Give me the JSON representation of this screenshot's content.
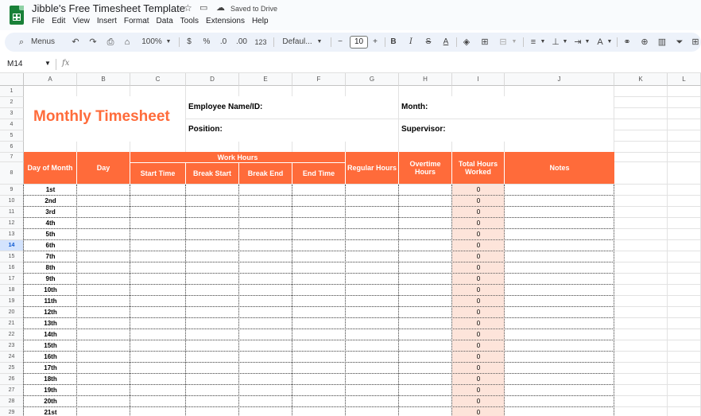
{
  "app": {
    "doc_title": "Jibble's Free Timesheet Template",
    "save_status": "Saved to Drive",
    "menu": [
      "File",
      "Edit",
      "View",
      "Insert",
      "Format",
      "Data",
      "Tools",
      "Extensions",
      "Help"
    ]
  },
  "toolbar": {
    "menus_label": "Menus",
    "zoom": "100%",
    "currency": "$",
    "percent": "%",
    "dec_decrease": ".0",
    "dec_increase": ".00",
    "number_format": "123",
    "font": "Defaul...",
    "font_size": "10",
    "bold": "B",
    "italic": "I",
    "strike": "S",
    "text_color": "A"
  },
  "formula_bar": {
    "cell_ref": "M14",
    "fx": "fx"
  },
  "columns": [
    "A",
    "B",
    "C",
    "D",
    "E",
    "F",
    "G",
    "H",
    "I",
    "J",
    "K",
    "L"
  ],
  "rows": [
    "1",
    "2",
    "3",
    "4",
    "5",
    "6",
    "7",
    "8",
    "9",
    "10",
    "11",
    "12",
    "13",
    "14",
    "15",
    "16",
    "17",
    "18",
    "19",
    "20",
    "21",
    "22",
    "23",
    "24",
    "25",
    "26",
    "27",
    "28",
    "29"
  ],
  "active_row": "14",
  "sheet": {
    "title": "Monthly Timesheet",
    "employee_label": "Employee Name/ID:",
    "position_label": "Position:",
    "month_label": "Month:",
    "supervisor_label": "Supervisor:",
    "headers": {
      "day_of_month": "Day of Month",
      "day": "Day",
      "work_hours": "Work Hours",
      "start_time": "Start Time",
      "break_start": "Break Start",
      "break_end": "Break End",
      "end_time": "End Time",
      "regular_hours": "Regular Hours",
      "overtime_hours": "Overtime Hours",
      "total_hours": "Total Hours Worked",
      "notes": "Notes"
    },
    "days": [
      "1st",
      "2nd",
      "3rd",
      "4th",
      "5th",
      "6th",
      "7th",
      "8th",
      "9th",
      "10th",
      "11th",
      "12th",
      "13th",
      "14th",
      "15th",
      "16th",
      "17th",
      "18th",
      "19th",
      "20th",
      "21st"
    ],
    "total_value": "0"
  },
  "colors": {
    "accent": "#ff6b3a",
    "total_fill": "#fde4da"
  }
}
